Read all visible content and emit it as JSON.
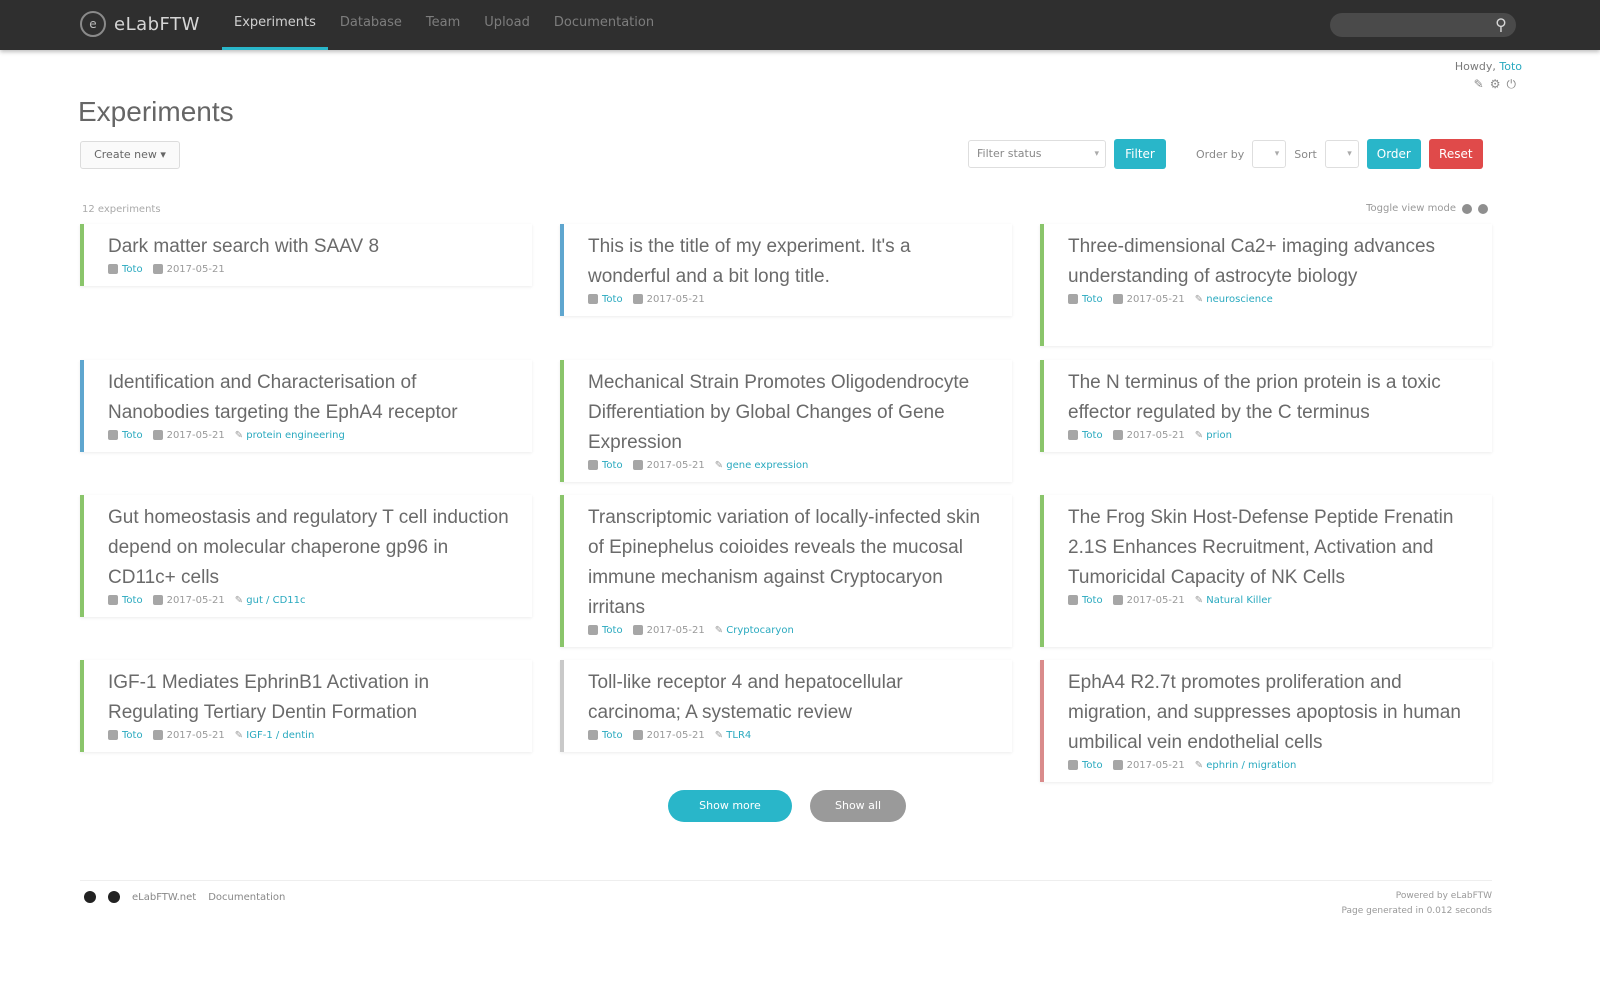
{
  "app": {
    "brand": "eLabFTW",
    "brand_logo": "e"
  },
  "nav": {
    "items": [
      {
        "label": "Experiments",
        "active": true
      },
      {
        "label": "Database",
        "active": false
      },
      {
        "label": "Team",
        "active": false
      },
      {
        "label": "Upload",
        "active": false
      },
      {
        "label": "Documentation",
        "active": false
      }
    ]
  },
  "search": {
    "placeholder": ""
  },
  "user": {
    "prefix": "Howdy,",
    "name": "Toto"
  },
  "page": {
    "title": "Experiments"
  },
  "toolbar": {
    "create_label": "Create new ▾",
    "filter_placeholder": "Filter status",
    "filter_button": "Filter",
    "order_label": "Order by",
    "sort_label": "Sort",
    "order_button": "Order",
    "reset_button": "Reset"
  },
  "list": {
    "count_text": "12 experiments",
    "view_label": "Toggle view mode"
  },
  "colors": {
    "accent": "#29b6c9",
    "success": "#8ac56b",
    "info": "#5fa6cf",
    "danger": "#e04a4a",
    "fail": "#d98b8b",
    "neutral": "#c9c9c9"
  },
  "experiments": [
    {
      "title": "Dark matter search with SAAV 8",
      "owner": "Toto",
      "date": "2017-05-21",
      "tag": "",
      "status_color": "#8ac56b"
    },
    {
      "title": "This is the title of my experiment. It's a wonderful and a bit long title.",
      "owner": "Toto",
      "date": "2017-05-21",
      "tag": "",
      "status_color": "#5fa6cf"
    },
    {
      "title": "Three-dimensional Ca2+ imaging advances understanding of astrocyte biology",
      "owner": "Toto",
      "date": "2017-05-21",
      "tag": "neuroscience",
      "status_color": "#8ac56b"
    },
    {
      "title": "Identification and Characterisation of Nanobodies targeting the EphA4 receptor",
      "owner": "Toto",
      "date": "2017-05-21",
      "tag": "protein engineering",
      "status_color": "#5fa6cf"
    },
    {
      "title": "Mechanical Strain Promotes Oligodendrocyte Differentiation by Global Changes of Gene Expression",
      "owner": "Toto",
      "date": "2017-05-21",
      "tag": "gene expression",
      "status_color": "#8ac56b"
    },
    {
      "title": "The N terminus of the prion protein is a toxic effector regulated by the C terminus",
      "owner": "Toto",
      "date": "2017-05-21",
      "tag": "prion",
      "status_color": "#8ac56b"
    },
    {
      "title": "Gut homeostasis and regulatory T cell induction depend on molecular chaperone gp96 in CD11c+ cells",
      "owner": "Toto",
      "date": "2017-05-21",
      "tag": "gut / CD11c",
      "status_color": "#8ac56b"
    },
    {
      "title": "Transcriptomic variation of locally-infected skin of Epinephelus coioides reveals the mucosal immune mechanism against Cryptocaryon irritans",
      "owner": "Toto",
      "date": "2017-05-21",
      "tag": "Cryptocaryon",
      "status_color": "#8ac56b"
    },
    {
      "title": "The Frog Skin Host-Defense Peptide Frenatin 2.1S Enhances Recruitment, Activation and Tumoricidal Capacity of NK Cells",
      "owner": "Toto",
      "date": "2017-05-21",
      "tag": "Natural Killer",
      "status_color": "#8ac56b"
    },
    {
      "title": "IGF-1 Mediates EphrinB1 Activation in Regulating Tertiary Dentin Formation",
      "owner": "Toto",
      "date": "2017-05-21",
      "tag": "IGF-1 / dentin",
      "status_color": "#8ac56b"
    },
    {
      "title": "Toll-like receptor 4 and hepatocellular carcinoma; A systematic review",
      "owner": "Toto",
      "date": "2017-05-21",
      "tag": "TLR4",
      "status_color": "#c9c9c9"
    },
    {
      "title": "EphA4 R2.7t promotes proliferation and migration, and suppresses apoptosis in human umbilical vein endothelial cells",
      "owner": "Toto",
      "date": "2017-05-21",
      "tag": "ephrin / migration",
      "status_color": "#d98b8b"
    }
  ],
  "pager": {
    "show_more": "Show more",
    "show_all": "Show all"
  },
  "footer": {
    "links": [
      "eLabFTW.net",
      "Documentation"
    ],
    "powered": "Powered by eLabFTW",
    "page_gen": "Page generated in 0.012 seconds"
  }
}
